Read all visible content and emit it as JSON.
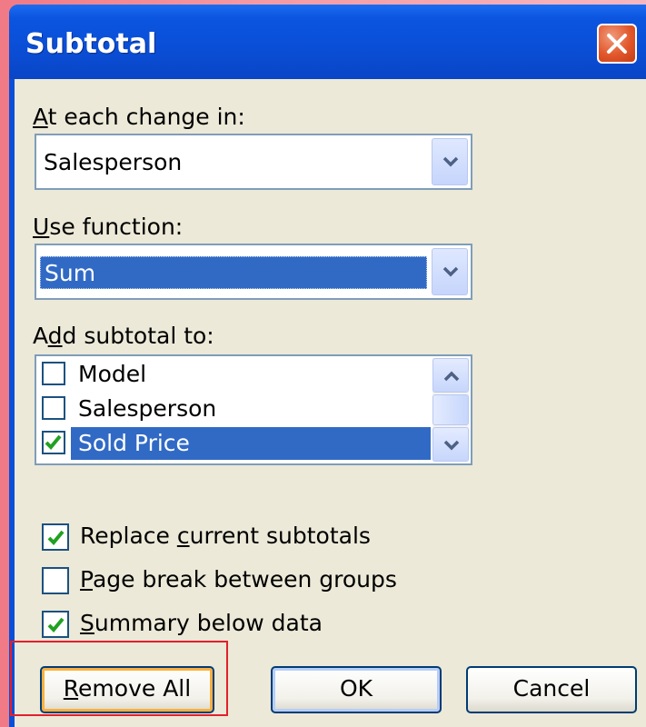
{
  "window": {
    "title": "Subtotal"
  },
  "at_each_change_in": {
    "label_prefix": "",
    "label_mnemonic": "A",
    "label_rest": "t each change in:",
    "value": "Salesperson"
  },
  "use_function": {
    "label_mnemonic": "U",
    "label_rest": "se function:",
    "value": "Sum"
  },
  "add_subtotal_to": {
    "label_a": "A",
    "label_mnemonic": "d",
    "label_rest": "d subtotal to:",
    "items": [
      {
        "label": "Model",
        "checked": false
      },
      {
        "label": "Salesperson",
        "checked": false
      },
      {
        "label": "Sold Price",
        "checked": true
      }
    ]
  },
  "options": {
    "replace": {
      "pre": "Replace ",
      "mnemonic": "c",
      "post": "urrent subtotals",
      "checked": true
    },
    "page_break": {
      "pre": "",
      "mnemonic": "P",
      "post": "age break between groups",
      "checked": false
    },
    "summary": {
      "pre": "",
      "mnemonic": "S",
      "post": "ummary below data",
      "checked": true
    }
  },
  "buttons": {
    "remove_all": {
      "mnemonic": "R",
      "rest": "emove All"
    },
    "ok": "OK",
    "cancel": "Cancel"
  },
  "colors": {
    "titlebar": "#0a4ed6",
    "selection": "#316ac5",
    "highlight_box": "#e2202c"
  }
}
